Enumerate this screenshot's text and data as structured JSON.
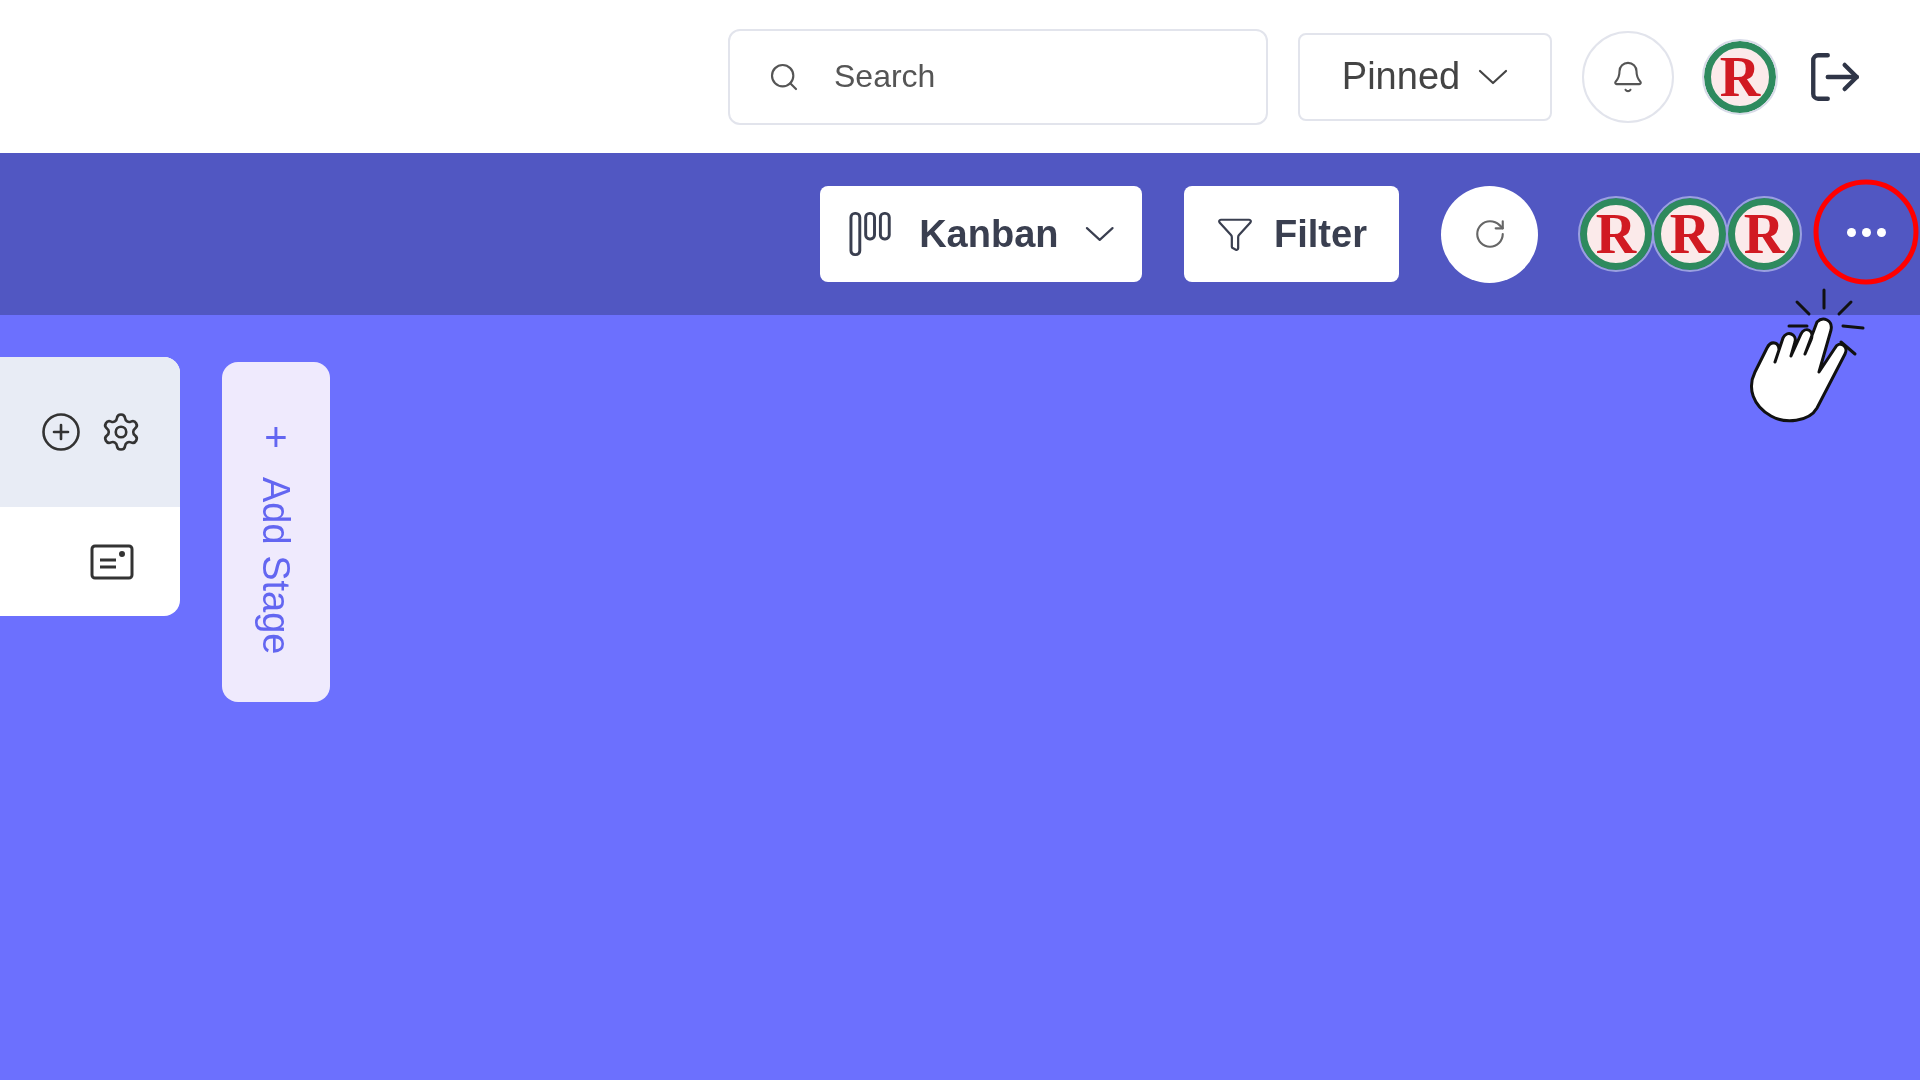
{
  "header": {
    "search": {
      "placeholder": "Search"
    },
    "pinned": {
      "label": "Pinned"
    },
    "avatar": {
      "initial": "R"
    }
  },
  "toolbar": {
    "view": {
      "label": "Kanban"
    },
    "filter": {
      "label": "Filter"
    },
    "members": [
      {
        "initial": "R"
      },
      {
        "initial": "R"
      },
      {
        "initial": "R"
      }
    ]
  },
  "board": {
    "add_stage": {
      "icon": "+",
      "label": "Add Stage"
    }
  }
}
